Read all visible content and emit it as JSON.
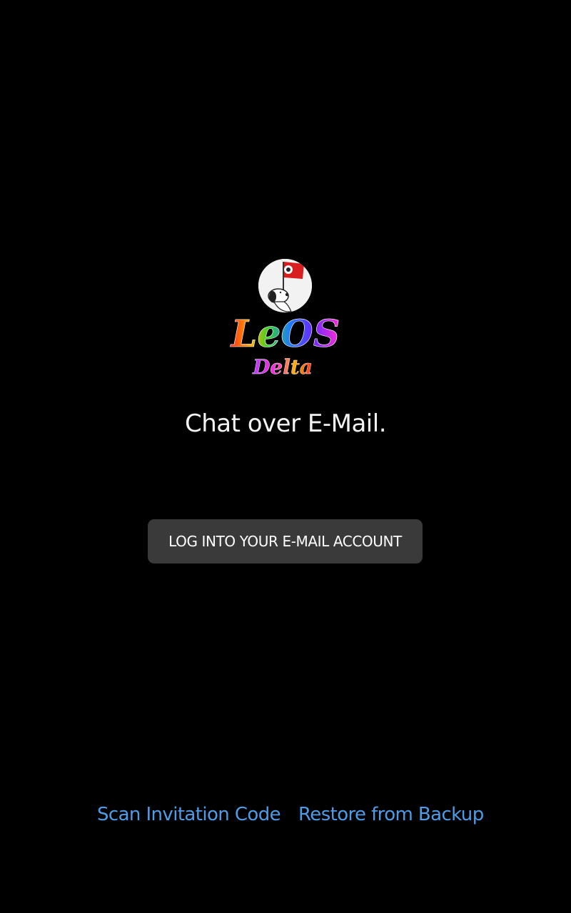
{
  "app": {
    "logo_title": "LeOS",
    "logo_subtitle": "Delta"
  },
  "welcome": {
    "tagline": "Chat over E-Mail.",
    "login_button_label": "LOG INTO YOUR E-MAIL ACCOUNT"
  },
  "footer": {
    "scan_label": "Scan Invitation Code",
    "restore_label": "Restore from Backup"
  },
  "colors": {
    "background": "#000000",
    "button_bg": "#3a3a3a",
    "link": "#4e9be6",
    "text": "#f2f2f2"
  }
}
